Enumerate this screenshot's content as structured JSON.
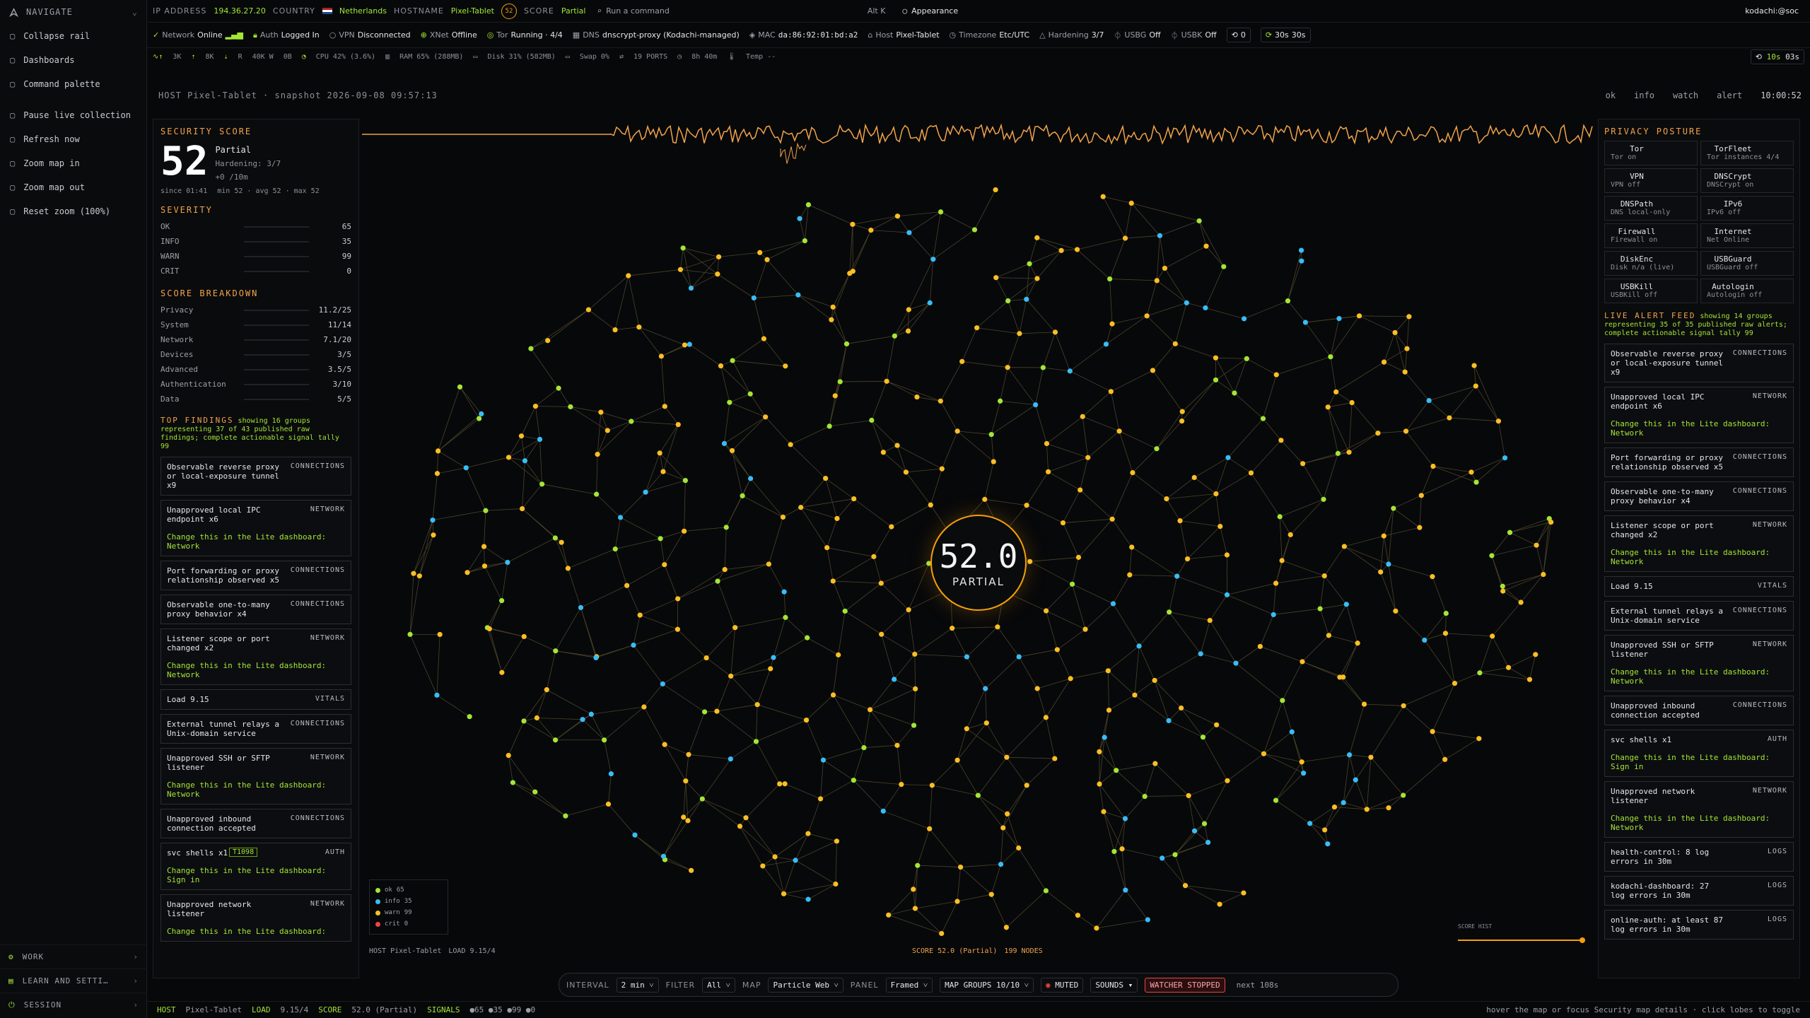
{
  "nav": {
    "title": "NAVIGATE",
    "items": [
      {
        "icon": "collapse-icon",
        "label": "Collapse rail"
      },
      {
        "icon": "dashboard-icon",
        "label": "Dashboards"
      },
      {
        "icon": "search-icon",
        "label": "Command palette"
      },
      {
        "icon": "pause-icon",
        "label": "Pause live collection"
      },
      {
        "icon": "refresh-icon",
        "label": "Refresh now"
      },
      {
        "icon": "zoom-in-icon",
        "label": "Zoom map in"
      },
      {
        "icon": "zoom-out-icon",
        "label": "Zoom map out"
      },
      {
        "icon": "reset-icon",
        "label": "Reset zoom (100%)"
      }
    ],
    "sections": [
      "WORK",
      "LEARN AND SETTI…",
      "SESSION"
    ]
  },
  "top": {
    "ip_label": "IP ADDRESS",
    "ip": "194.36.27.20",
    "country_label": "COUNTRY",
    "country": "Netherlands",
    "host_label": "HOSTNAME",
    "host": "Pixel-Tablet",
    "score_label": "SCORE",
    "score": "Partial",
    "score_badge": "52",
    "search_placeholder": "Run a command",
    "shortcut": "Alt K",
    "appearance": "Appearance",
    "user": "kodachi:@soc"
  },
  "status": {
    "network": "Network",
    "network_val": "Online",
    "auth": "Auth",
    "auth_val": "Logged In",
    "vpn": "VPN",
    "vpn_val": "Disconnected",
    "xnet": "XNet",
    "xnet_val": "Offline",
    "tor": "Tor",
    "tor_val": "Running · 4/4",
    "dns": "DNS",
    "dns_val": "dnscrypt-proxy (Kodachi-managed)",
    "mac": "MAC",
    "mac_val": "da:86:92:01:bd:a2",
    "host": "Host",
    "host_val": "Pixel-Tablet",
    "tz": "Timezone",
    "tz_val": "Etc/UTC",
    "hard": "Hardening",
    "hard_val": "3/7",
    "usbg": "USBG",
    "usbg_val": "Off",
    "usbk": "USBK",
    "usbk_val": "Off",
    "count": "0",
    "i30": "30s",
    "i30b": "30s"
  },
  "vitals": {
    "k1": "3K",
    "k2": "8K",
    "r": "R",
    "w": "40K W",
    "b": "0B",
    "cpu": "CPU 42% (3.6%)",
    "ram": "RAM 65% (288MB)",
    "disk": "Disk 31% (582MB)",
    "swap": "Swap 0%",
    "ports": "19 PORTS",
    "up": "8h 40m",
    "temp": "Temp --",
    "r1": "10s",
    "r2": "03s"
  },
  "host_line": "HOST Pixel-Tablet · snapshot 2026-09-08 09:57:13",
  "legend_top": [
    "ok",
    "info",
    "watch",
    "alert"
  ],
  "clock": "10:00:52",
  "security": {
    "title": "SECURITY SCORE",
    "score": "52",
    "status": "Partial",
    "hardening": "Hardening: 3/7",
    "delta": "+0 /10m",
    "since": "since 01:41",
    "stats": "min 52 · avg 52 · max 52"
  },
  "severity": {
    "title": "SEVERITY",
    "rows": [
      {
        "name": "OK",
        "value": "65"
      },
      {
        "name": "INFO",
        "value": "35"
      },
      {
        "name": "WARN",
        "value": "99"
      },
      {
        "name": "CRIT",
        "value": "0"
      }
    ]
  },
  "breakdown": {
    "title": "SCORE BREAKDOWN",
    "rows": [
      {
        "name": "Privacy",
        "value": "11.2/25"
      },
      {
        "name": "System",
        "value": "11/14"
      },
      {
        "name": "Network",
        "value": "7.1/20"
      },
      {
        "name": "Devices",
        "value": "3/5"
      },
      {
        "name": "Advanced",
        "value": "3.5/5"
      },
      {
        "name": "Authentication",
        "value": "3/10"
      },
      {
        "name": "Data",
        "value": "5/5"
      }
    ]
  },
  "findings": {
    "title": "TOP FINDINGS",
    "sub": "showing 16 groups representing 37 of 43 published raw findings; complete actionable signal tally 99",
    "items": [
      {
        "t": "Observable reverse proxy or local-exposure tunnel x9",
        "c": "CONNECTIONS",
        "h": ""
      },
      {
        "t": "Unapproved local IPC endpoint x6",
        "c": "NETWORK",
        "h": "Change this in the Lite dashboard: Network"
      },
      {
        "t": "Port forwarding or proxy relationship observed x5",
        "c": "CONNECTIONS",
        "h": ""
      },
      {
        "t": "Observable one-to-many proxy behavior x4",
        "c": "CONNECTIONS",
        "h": ""
      },
      {
        "t": "Listener scope or port changed x2",
        "c": "NETWORK",
        "h": "Change this in the Lite dashboard: Network"
      },
      {
        "t": "Load 9.15",
        "c": "VITALS",
        "h": ""
      },
      {
        "t": "External tunnel relays a Unix-domain service",
        "c": "CONNECTIONS",
        "h": ""
      },
      {
        "t": "Unapproved SSH or SFTP listener",
        "c": "NETWORK",
        "h": "Change this in the Lite dashboard: Network"
      },
      {
        "t": "Unapproved inbound connection accepted",
        "c": "CONNECTIONS",
        "h": ""
      },
      {
        "t": "svc shells x1",
        "c": "AUTH",
        "h": "Change this in the Lite dashboard: Sign in",
        "tag": "T1098"
      },
      {
        "t": "Unapproved network listener",
        "c": "NETWORK",
        "h": "Change this in the Lite dashboard:"
      }
    ]
  },
  "privacy": {
    "title": "PRIVACY POSTURE",
    "tiles": [
      {
        "a": "Tor",
        "b": "Tor on"
      },
      {
        "a": "TorFleet",
        "b": "Tor instances 4/4"
      },
      {
        "a": "VPN",
        "b": "VPN off"
      },
      {
        "a": "DNSCrypt",
        "b": "DNSCrypt on"
      },
      {
        "a": "DNSPath",
        "b": "DNS local-only"
      },
      {
        "a": "IPv6",
        "b": "IPv6 off"
      },
      {
        "a": "Firewall",
        "b": "Firewall on"
      },
      {
        "a": "Internet",
        "b": "Net Online"
      },
      {
        "a": "DiskEnc",
        "b": "Disk n/a (live)"
      },
      {
        "a": "USBGuard",
        "b": "USBGuard off"
      },
      {
        "a": "USBKill",
        "b": "USBKill off"
      },
      {
        "a": "Autologin",
        "b": "Autologin off"
      }
    ]
  },
  "feed": {
    "title": "LIVE ALERT FEED",
    "sub": "showing 14 groups representing 35 of 35 published raw alerts; complete actionable signal tally 99",
    "items": [
      {
        "t": "Observable reverse proxy or local-exposure tunnel x9",
        "c": "CONNECTIONS",
        "h": ""
      },
      {
        "t": "Unapproved local IPC endpoint x6",
        "c": "NETWORK",
        "h": "Change this in the Lite dashboard: Network"
      },
      {
        "t": "Port forwarding or proxy relationship observed x5",
        "c": "CONNECTIONS",
        "h": ""
      },
      {
        "t": "Observable one-to-many proxy behavior x4",
        "c": "CONNECTIONS",
        "h": ""
      },
      {
        "t": "Listener scope or port changed x2",
        "c": "NETWORK",
        "h": "Change this in the Lite dashboard: Network"
      },
      {
        "t": "Load 9.15",
        "c": "VITALS",
        "h": ""
      },
      {
        "t": "External tunnel relays a Unix-domain service",
        "c": "CONNECTIONS",
        "h": ""
      },
      {
        "t": "Unapproved SSH or SFTP listener",
        "c": "NETWORK",
        "h": "Change this in the Lite dashboard: Network"
      },
      {
        "t": "Unapproved inbound connection accepted",
        "c": "CONNECTIONS",
        "h": ""
      },
      {
        "t": "svc shells x1",
        "c": "AUTH",
        "h": "Change this in the Lite dashboard: Sign in"
      },
      {
        "t": "Unapproved network listener",
        "c": "NETWORK",
        "h": "Change this in the Lite dashboard: Network"
      },
      {
        "t": "health-control: 8 log errors in 30m",
        "c": "LOGS",
        "h": ""
      },
      {
        "t": "kodachi-dashboard: 27 log errors in 30m",
        "c": "LOGS",
        "h": ""
      },
      {
        "t": "online-auth: at least 87 log errors in 30m",
        "c": "LOGS",
        "h": ""
      }
    ]
  },
  "map": {
    "score": "52.0",
    "state": "PARTIAL",
    "legend": [
      {
        "n": "ok",
        "v": "65"
      },
      {
        "n": "info",
        "v": "35"
      },
      {
        "n": "warn",
        "v": "99"
      },
      {
        "n": "crit",
        "v": "0"
      }
    ],
    "host": "HOST Pixel-Tablet",
    "load": "LOAD 9.15/4",
    "score_line": "SCORE 52.0 (Partial)",
    "nodes": "199 NODES",
    "score_hist": "SCORE HIST",
    "colors": {
      "ok": "#a3e635",
      "info": "#38bdf8",
      "warn": "#fbbf24",
      "crit": "#ef4444",
      "accent": "#f59e0b"
    }
  },
  "controls": {
    "interval_l": "INTERVAL",
    "interval": "2 min",
    "filter_l": "FILTER",
    "filter": "All",
    "map_l": "MAP",
    "map": "Particle Web",
    "panel_l": "PANEL",
    "panel": "Framed",
    "groups": "MAP GROUPS 10/10",
    "muted": "MUTED",
    "sounds": "SOUNDS",
    "watcher": "WATCHER STOPPED",
    "next": "next 108s"
  },
  "footer": {
    "host_l": "HOST",
    "host": "Pixel-Tablet",
    "load_l": "LOAD",
    "load": "9.15/4",
    "score_l": "SCORE",
    "score": "52.0 (Partial)",
    "sig_l": "SIGNALS",
    "sig": "●65 ●35 ●99 ●0",
    "hint": "hover the map or focus Security map details · click lobes to toggle"
  }
}
